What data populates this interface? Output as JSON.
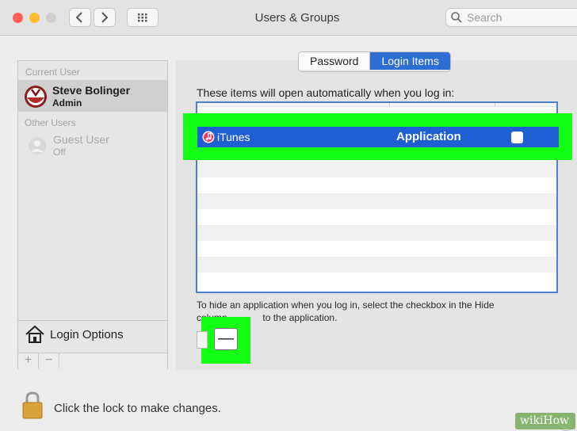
{
  "window": {
    "title": "Users & Groups"
  },
  "toolbar": {
    "search_placeholder": "Search"
  },
  "sidebar": {
    "current_user_label": "Current User",
    "current_user": {
      "name": "Steve Bolinger",
      "role": "Admin"
    },
    "other_users_label": "Other Users",
    "other_users": [
      {
        "name": "Guest User",
        "status": "Off"
      }
    ],
    "login_options_label": "Login Options",
    "add_symbol": "+",
    "remove_symbol": "−"
  },
  "tabs": [
    {
      "label": "Password",
      "selected": false
    },
    {
      "label": "Login Items",
      "selected": true
    }
  ],
  "login_items": {
    "intro": "These items will open automatically when you log in:",
    "items": [
      {
        "name": "iTunes",
        "kind": "Application",
        "hide": false
      }
    ],
    "hint_line1": "To hide an application when you log in, select the checkbox in the Hide",
    "hint_line2_start": "column ",
    "hint_line2_end": " to the application.",
    "remove_symbol": "—"
  },
  "footer": {
    "lock_text": "Click the lock to make changes.",
    "help_symbol": "?"
  },
  "colors": {
    "selection_blue": "#1f5fd4",
    "highlight_green": "#13ff13",
    "tab_selected": "#2d6ed4"
  }
}
